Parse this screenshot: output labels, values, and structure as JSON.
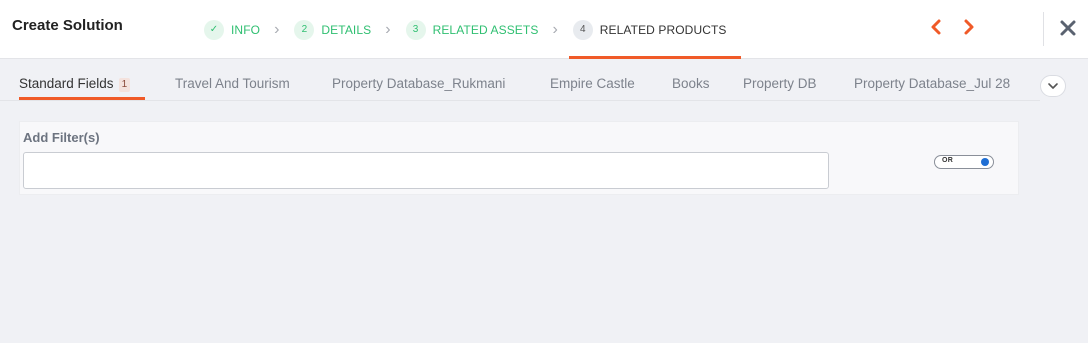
{
  "header": {
    "title": "Create Solution",
    "steps": [
      {
        "number": "✓",
        "label": "INFO",
        "state": "complete"
      },
      {
        "number": "2",
        "label": "DETAILS",
        "state": "complete"
      },
      {
        "number": "3",
        "label": "RELATED ASSETS",
        "state": "complete"
      },
      {
        "number": "4",
        "label": "RELATED PRODUCTS",
        "state": "active"
      }
    ],
    "prev_icon": "chevron-left-icon",
    "next_icon": "chevron-right-icon",
    "close_icon": "close-icon"
  },
  "tabs": {
    "items": [
      {
        "label": "Standard Fields",
        "badge": "1",
        "active": true
      },
      {
        "label": "Travel And Tourism",
        "active": false
      },
      {
        "label": "Property Database_Rukmani",
        "active": false
      },
      {
        "label": "Empire Castle",
        "active": false
      },
      {
        "label": "Books",
        "active": false
      },
      {
        "label": "Property DB",
        "active": false
      },
      {
        "label": "Property Database_Jul 28",
        "active": false
      }
    ],
    "more_icon": "chevron-down-icon"
  },
  "filter": {
    "label": "Add Filter(s)",
    "value": "",
    "placeholder": "",
    "toggle_label": "OR",
    "toggle_on": true
  },
  "colors": {
    "accent": "#f05a28",
    "complete": "#2fbf71",
    "toggle": "#1f6ed4",
    "background": "#f0f1f5"
  }
}
